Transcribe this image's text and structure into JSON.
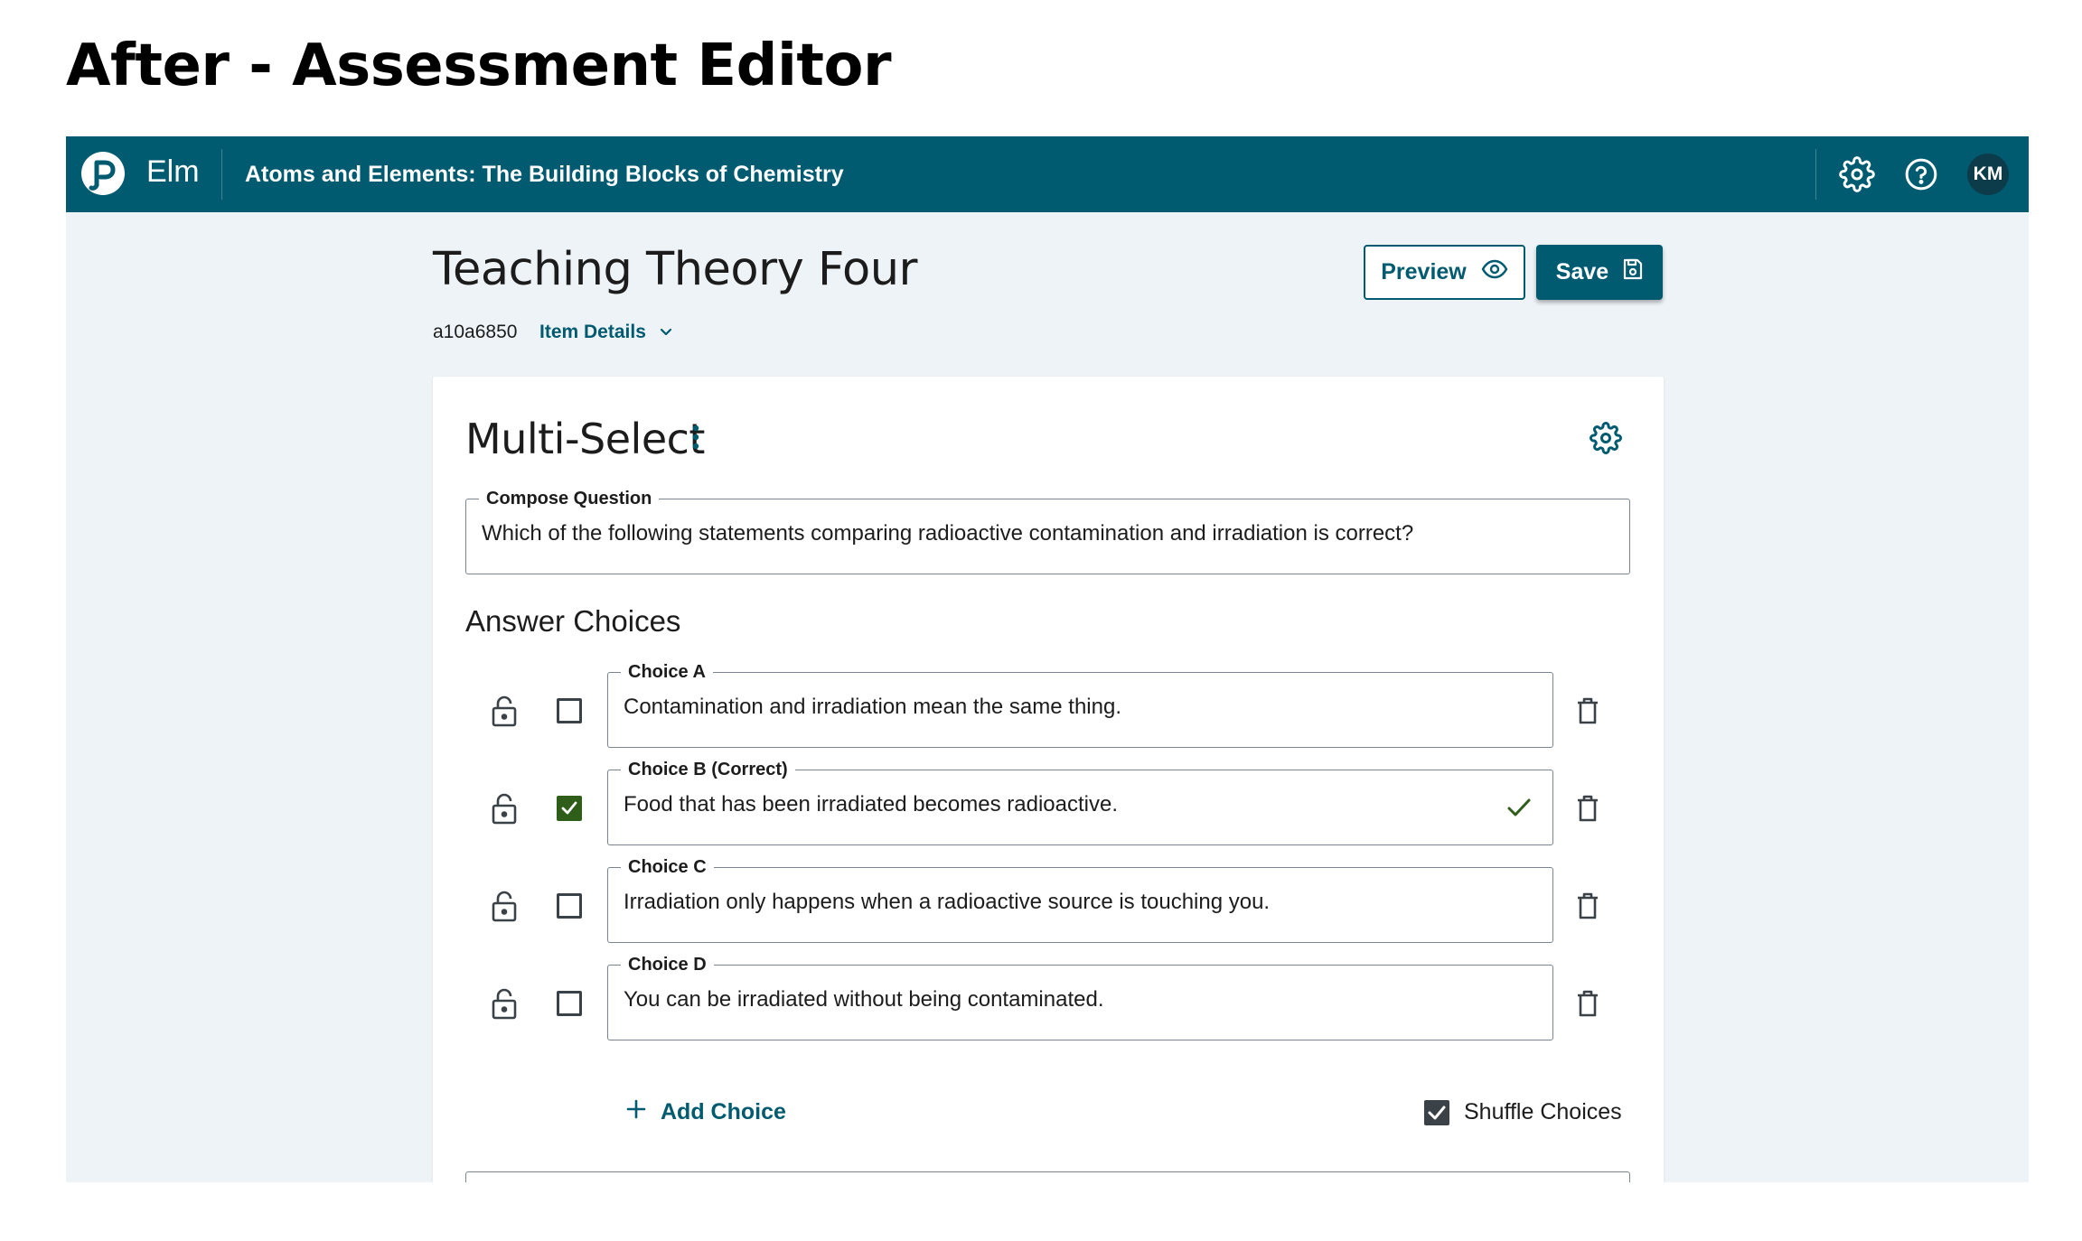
{
  "page": {
    "heading": "After - Assessment Editor"
  },
  "topbar": {
    "app_name": "Elm",
    "course_title": "Atoms and Elements: The Building Blocks of Chemistry",
    "avatar_initials": "KM",
    "logo_icon": "pearson-logo-icon",
    "settings_icon": "gear-icon",
    "help_icon": "help-circle-icon",
    "bg_color": "#005a70"
  },
  "header": {
    "title": "Teaching Theory Four",
    "item_id": "a10a6850",
    "item_details_label": "Item Details",
    "preview_label": "Preview",
    "save_label": "Save"
  },
  "editor": {
    "type_title": "Multi-Select",
    "question": {
      "legend": "Compose Question",
      "value": "Which of the following statements comparing radioactive contamination and irradiation is correct?"
    },
    "answer_heading": "Answer Choices",
    "choices": [
      {
        "legend": "Choice A",
        "text": "Contamination and irradiation mean the same thing.",
        "correct": false
      },
      {
        "legend": "Choice B (Correct)",
        "text": "Food that has been irradiated becomes radioactive.",
        "correct": true
      },
      {
        "legend": "Choice C",
        "text": "Irradiation only happens when a radioactive source is touching you.",
        "correct": false
      },
      {
        "legend": "Choice D",
        "text": "You can be irradiated without being contaminated.",
        "correct": false
      }
    ],
    "add_choice_label": "Add Choice",
    "shuffle_label": "Shuffle Choices",
    "shuffle_checked": true,
    "correct_color": "#2e5e1a"
  }
}
